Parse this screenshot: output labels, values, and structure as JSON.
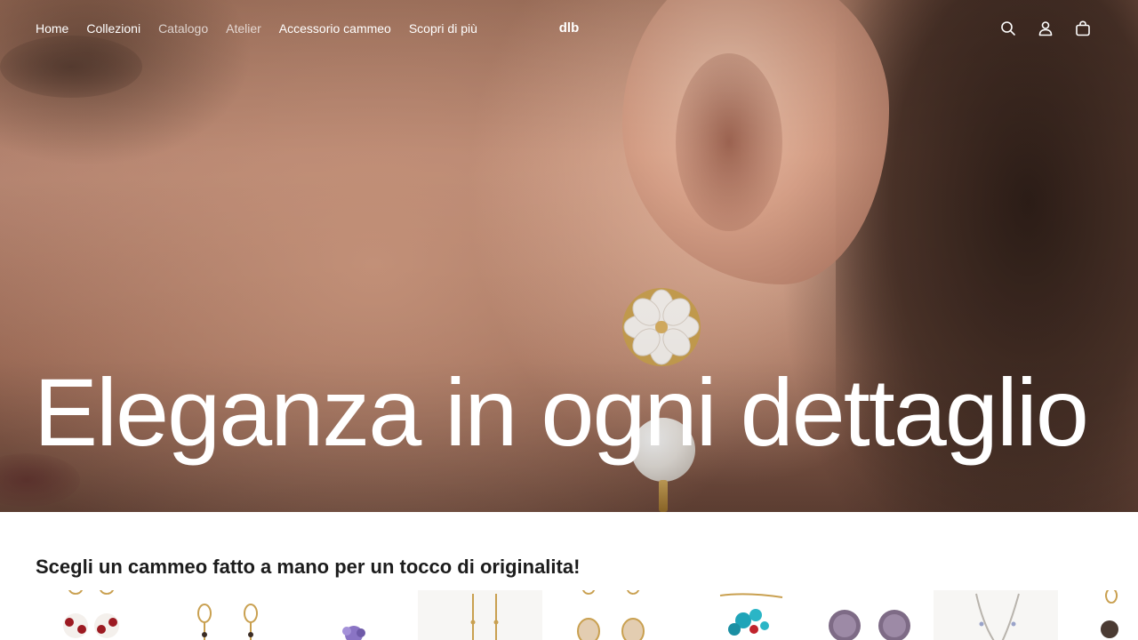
{
  "header": {
    "nav": [
      {
        "label": "Home",
        "muted": false
      },
      {
        "label": "Collezioni",
        "muted": false
      },
      {
        "label": "Catalogo",
        "muted": true
      },
      {
        "label": "Atelier",
        "muted": true
      },
      {
        "label": "Accessorio cammeo",
        "muted": false
      },
      {
        "label": "Scopri di più",
        "muted": false
      }
    ],
    "logo": "dlb",
    "icons": [
      "search-icon",
      "account-icon",
      "cart-icon"
    ]
  },
  "hero": {
    "title": "Eleganza in ogni dettaglio"
  },
  "collection": {
    "heading": "Scegli un cammeo fatto a mano per un tocco di originalita!",
    "products": [
      {
        "name": "product-earrings-red-white"
      },
      {
        "name": "product-earrings-hoop-gold"
      },
      {
        "name": "product-ring-purple"
      },
      {
        "name": "product-necklace-gold"
      },
      {
        "name": "product-earrings-cameo-beige"
      },
      {
        "name": "product-necklace-turquoise"
      },
      {
        "name": "product-earrings-lilac-round"
      },
      {
        "name": "product-necklace-silver"
      },
      {
        "name": "product-earrings-partial"
      }
    ]
  },
  "colors": {
    "text_white": "#ffffff",
    "text_dark": "#1c1c1c",
    "gold": "#c9a050",
    "pearl": "#f1ece6"
  }
}
